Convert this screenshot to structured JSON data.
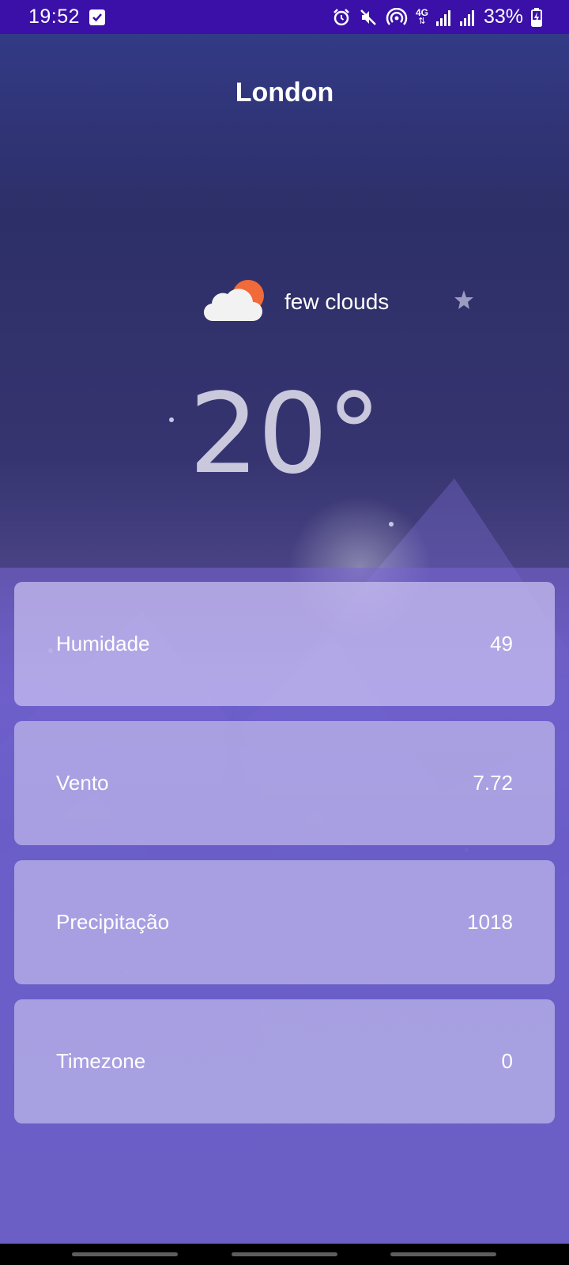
{
  "status_bar": {
    "time": "19:52",
    "network": "4G",
    "battery": "33%",
    "icons": [
      "check-box-icon",
      "alarm-icon",
      "mute-icon",
      "hotspot-icon",
      "signal-icon",
      "signal-icon-2",
      "battery-charging-icon"
    ]
  },
  "header": {
    "city": "London"
  },
  "weather": {
    "icon": "cloud-sun-icon",
    "description": "few clouds",
    "temperature": "20°"
  },
  "details": [
    {
      "label": "Humidade",
      "value": "49"
    },
    {
      "label": "Vento",
      "value": "7.72"
    },
    {
      "label": "Precipitação",
      "value": "1018"
    },
    {
      "label": "Timezone",
      "value": "0"
    }
  ],
  "colors": {
    "status_bar": "#3a10a8",
    "sun": "#f06a3a",
    "cloud": "#f2f2f2"
  }
}
